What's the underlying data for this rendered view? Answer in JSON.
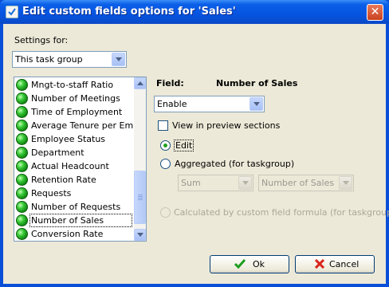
{
  "window": {
    "title": "Edit custom fields options for  'Sales'",
    "close_glyph": "✕"
  },
  "settings": {
    "label": "Settings for:",
    "selected": "This task group"
  },
  "list": {
    "items": [
      {
        "label": "Mngt-to-staff Ratio"
      },
      {
        "label": "Number of Meetings"
      },
      {
        "label": "Time of Employment"
      },
      {
        "label": "Average Tenure per Emplo"
      },
      {
        "label": "Employee Status"
      },
      {
        "label": "Department"
      },
      {
        "label": "Actual Headcount"
      },
      {
        "label": "Retention Rate"
      },
      {
        "label": "Requests"
      },
      {
        "label": "Number of Requests"
      },
      {
        "label": "Number of Sales"
      },
      {
        "label": "Conversion Rate"
      }
    ],
    "selected_index": 10
  },
  "field": {
    "label": "Field:",
    "name": "Number of Sales",
    "mode": "Enable",
    "view_in_preview_label": "View in preview sections",
    "view_in_preview_checked": false
  },
  "options": {
    "edit_label": "Edit",
    "aggregated_label": "Aggregated (for taskgroup)",
    "aggregate_function": "Sum",
    "aggregate_field": "Number of Sales",
    "formula_label": "Calculated by custom field formula (for taskgroup)",
    "selected": "edit"
  },
  "buttons": {
    "ok_label": "Ok",
    "cancel_label": "Cancel"
  },
  "colors": {
    "titlebar": "#0654e0",
    "dialog_bg": "#ece9d8",
    "status_ok_green": "#38c838",
    "cancel_red": "#d9261c"
  },
  "icons": {
    "title": "app-check-icon",
    "status": "green-status-dot-icon",
    "ok": "check-icon",
    "cancel": "x-icon"
  }
}
